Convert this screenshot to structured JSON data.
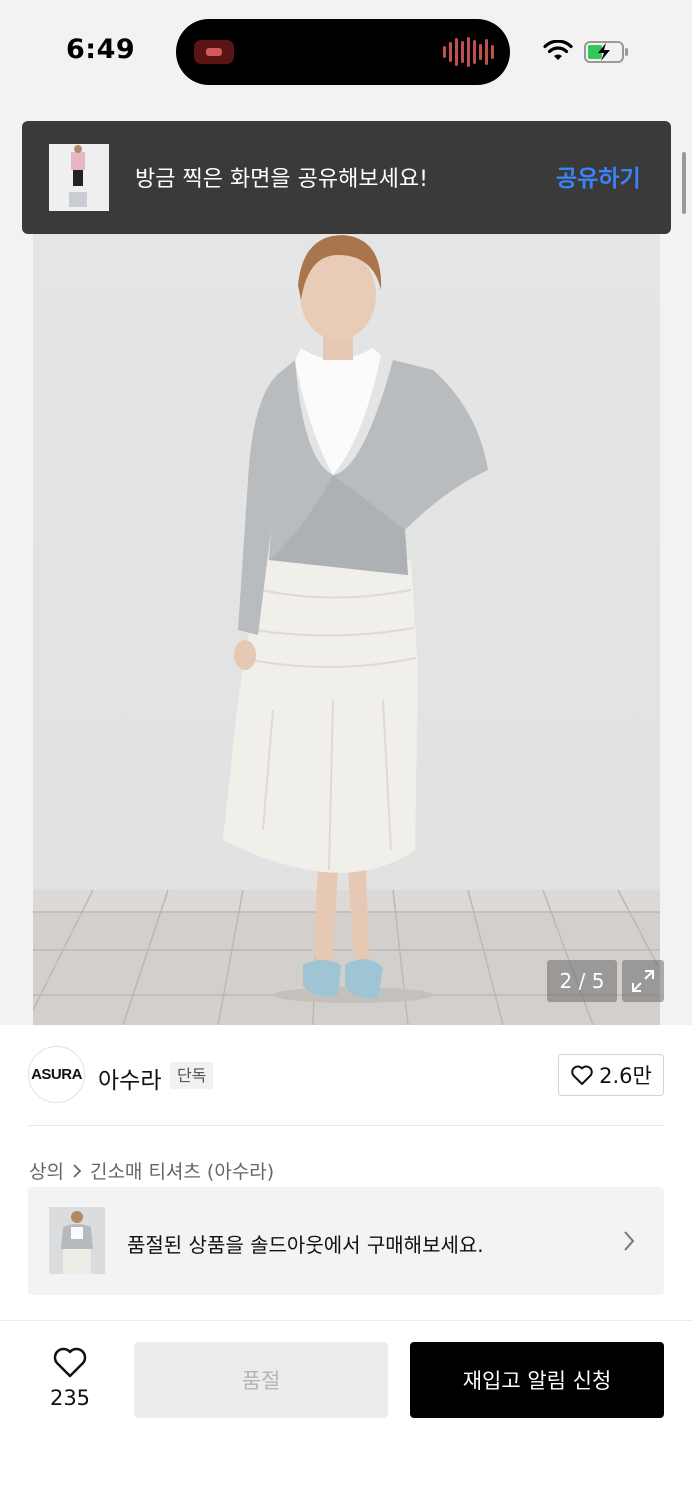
{
  "status_bar": {
    "time": "6:49",
    "icons": [
      "wifi-icon",
      "battery-charging-icon"
    ]
  },
  "toast": {
    "message": "방금 찍은 화면을 공유해보세요!",
    "action_label": "공유하기",
    "action_color": "#3b82f6"
  },
  "gallery": {
    "counter": "2 / 5",
    "current": 2,
    "total": 5
  },
  "brand": {
    "logo_text": "ASURA",
    "name": "아수라",
    "badge": "단독",
    "like_count": "2.6만"
  },
  "breadcrumb": {
    "category": "상의",
    "subcategory": "긴소매 티셔츠 (아수라)"
  },
  "soldout_card": {
    "text": "품절된 상품을 솔드아웃에서 구매해보세요."
  },
  "bottom_bar": {
    "wish_count": "235",
    "soldout_label": "품절",
    "restock_label": "재입고 알림 신청"
  },
  "colors": {
    "primary_button": "#000000",
    "disabled_button": "#ececec",
    "link_blue": "#3b82f6",
    "toast_bg": "#3a3a3a"
  }
}
